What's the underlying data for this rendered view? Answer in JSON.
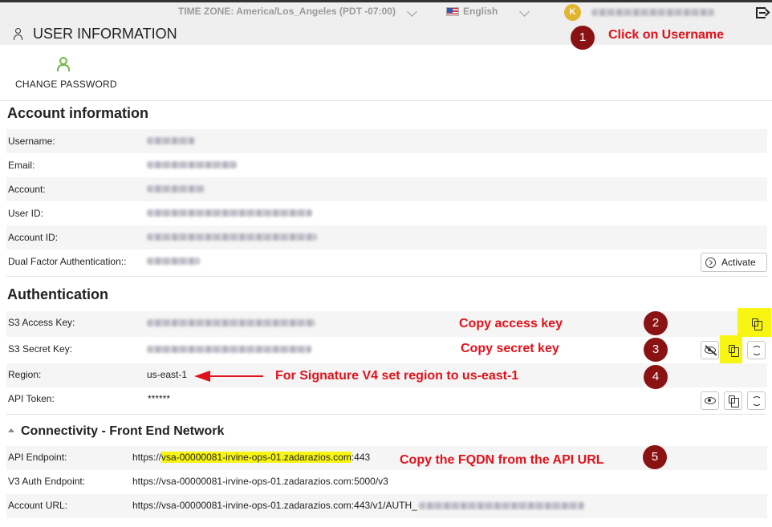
{
  "topbar": {
    "timezone": "TIME ZONE: America/Los_Angeles (PDT -07:00)",
    "language": "English",
    "avatar_initial": "K"
  },
  "header": {
    "title": "USER INFORMATION"
  },
  "actions": {
    "change_password": "CHANGE PASSWORD"
  },
  "account_info": {
    "title": "Account information",
    "rows": [
      {
        "label": "Username:"
      },
      {
        "label": "Email:"
      },
      {
        "label": "Account:"
      },
      {
        "label": "User ID:"
      },
      {
        "label": "Account ID:"
      },
      {
        "label": "Dual Factor Authentication::"
      }
    ],
    "activate_label": "Activate"
  },
  "authentication": {
    "title": "Authentication",
    "rows": [
      {
        "label": "S3 Access Key:"
      },
      {
        "label": "S3 Secret Key:"
      },
      {
        "label": "Region:",
        "value": "us-east-1"
      },
      {
        "label": "API Token:",
        "value": "******"
      }
    ]
  },
  "connectivity": {
    "title": "Connectivity - Front End Network",
    "rows": [
      {
        "label": "API Endpoint:",
        "prefix": "https://",
        "host": "vsa-00000081-irvine-ops-01.zadarazios.com",
        "suffix": ":443"
      },
      {
        "label": "V3 Auth Endpoint:",
        "value": "https://vsa-00000081-irvine-ops-01.zadarazios.com:5000/v3"
      },
      {
        "label": "Account URL:",
        "value": "https://vsa-00000081-irvine-ops-01.zadarazios.com:443/v1/AUTH_"
      }
    ]
  },
  "annotations": [
    {
      "number": "1",
      "text": "Click on Username"
    },
    {
      "number": "2",
      "text": "Copy access key"
    },
    {
      "number": "3",
      "text": "Copy secret key"
    },
    {
      "number": "4",
      "text": "For Signature V4 set region to us-east-1"
    },
    {
      "number": "5",
      "text": "Copy the FQDN from the API URL"
    }
  ],
  "colors": {
    "annotation_red": "#e0121b",
    "badge_red": "#8b1212",
    "highlight_yellow": "#f8f513",
    "accent_green": "#73b84b",
    "avatar_yellow": "#e2b530"
  },
  "icons": [
    "user-icon",
    "logout-icon",
    "chevron-down-icon",
    "copy-icon",
    "eye-icon",
    "eye-off-icon",
    "refresh-icon",
    "arrow-right-circle-icon",
    "triangle-up-icon",
    "flag-us-icon"
  ]
}
